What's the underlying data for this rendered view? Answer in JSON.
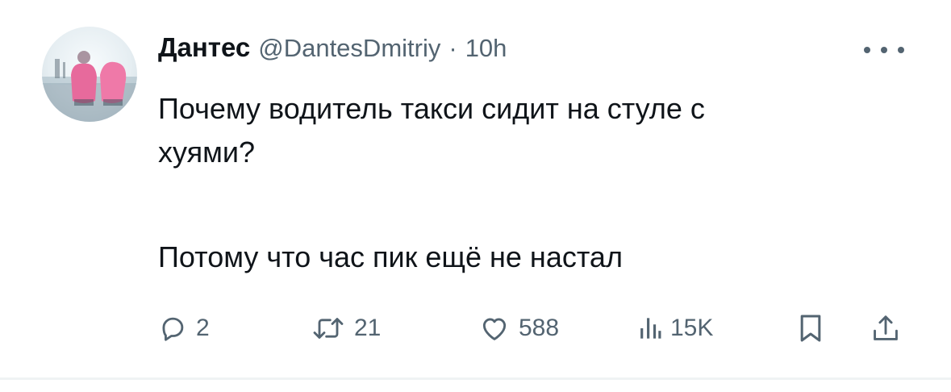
{
  "tweet": {
    "author_name": "Дантес",
    "author_handle": "@DantesDmitriy",
    "separator": "·",
    "time": "10h",
    "text_line1": "Почему водитель такси сидит на стуле с",
    "text_line2": "хуями?",
    "text_line3": "Потому что час пик ещё не настал"
  },
  "actions": {
    "replies": "2",
    "reposts": "21",
    "likes": "588",
    "views": "15K"
  },
  "icons": {
    "reply": "reply-icon",
    "repost": "repost-icon",
    "like": "heart-icon",
    "views": "views-icon",
    "bookmark": "bookmark-icon",
    "share": "share-icon",
    "more": "more-icon"
  },
  "colors": {
    "text_primary": "#0f1419",
    "text_secondary": "#536471",
    "divider": "#eff3f4"
  }
}
